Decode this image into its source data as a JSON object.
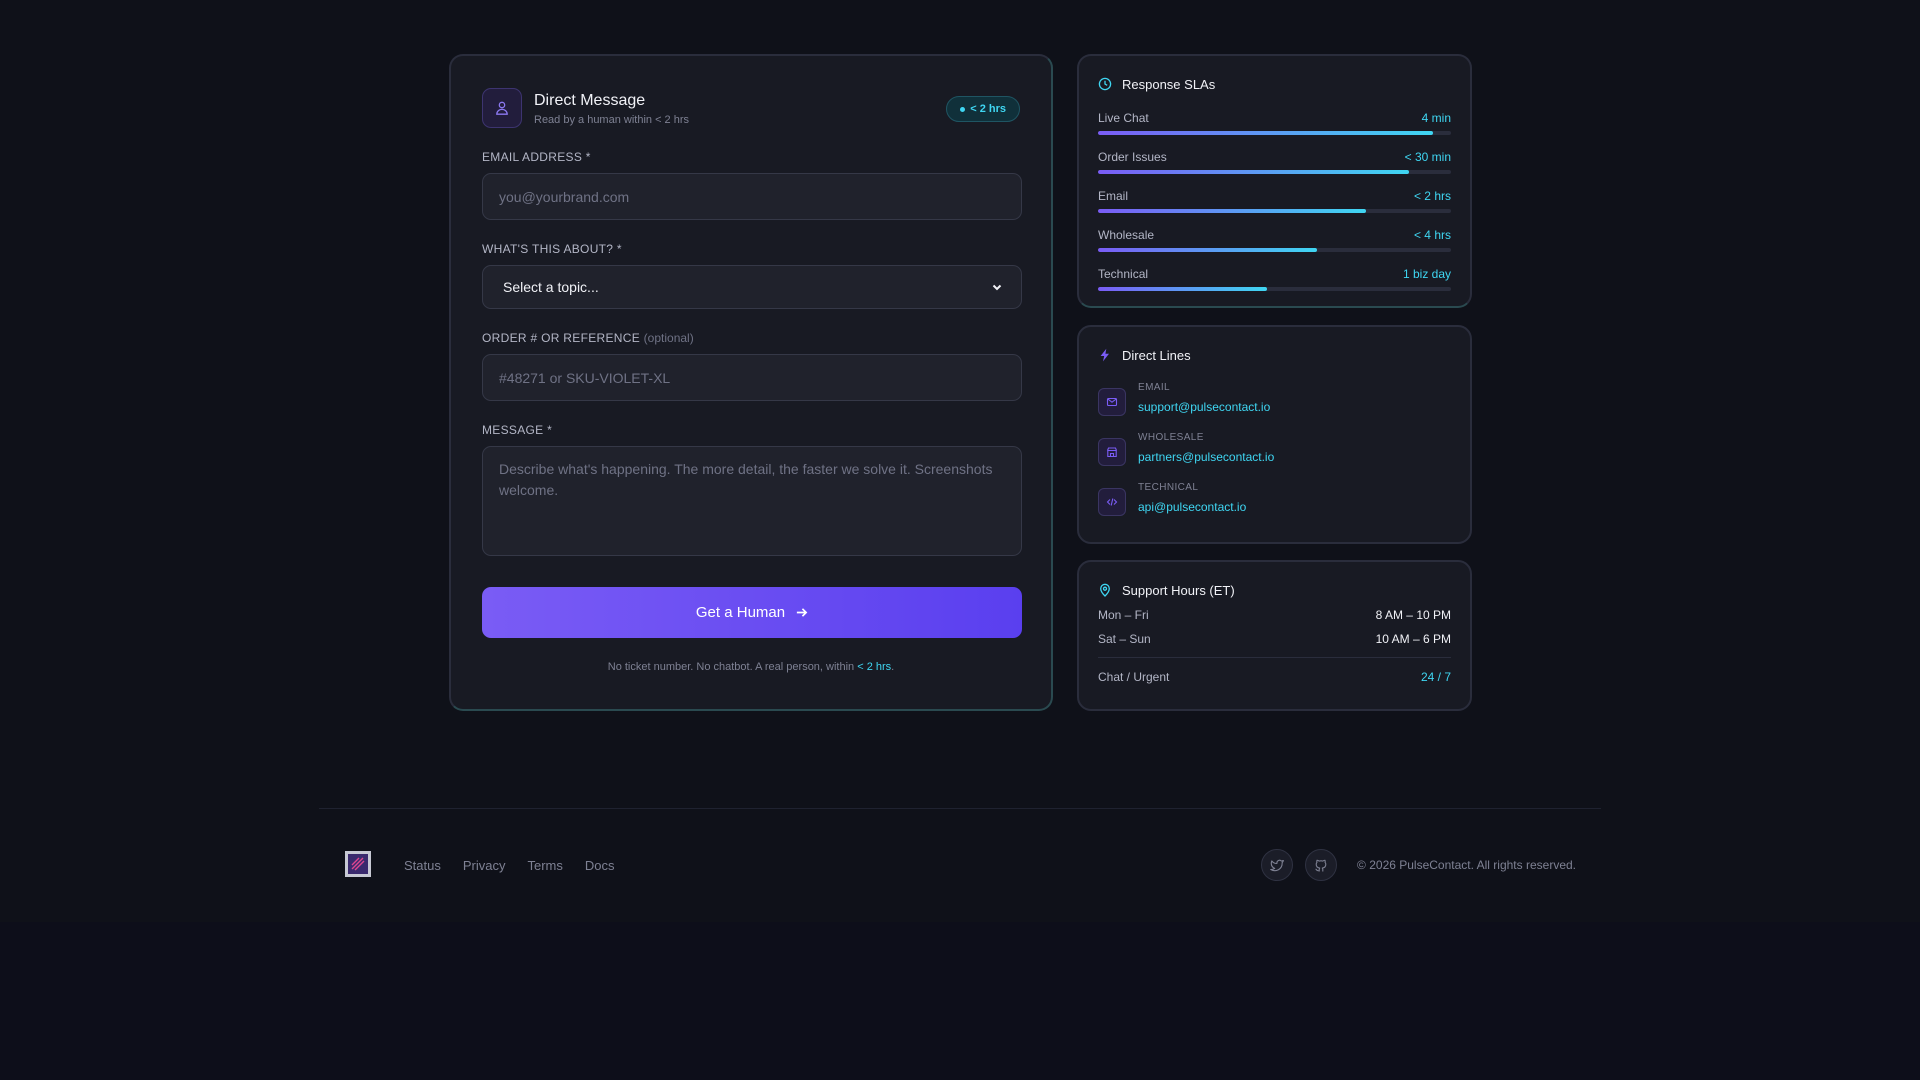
{
  "form": {
    "title": "Direct Message",
    "subtitle": "Read by a human within < 2 hrs",
    "badge": "< 2 hrs",
    "email_label": "EMAIL ADDRESS *",
    "email_placeholder": "you@yourbrand.com",
    "topic_label": "WHAT'S THIS ABOUT? *",
    "topic_value": "Select a topic...",
    "order_label": "ORDER # OR REFERENCE",
    "order_optional": "(optional)",
    "order_placeholder": "#48271 or SKU-VIOLET-XL",
    "message_label": "MESSAGE *",
    "message_placeholder": "Describe what's happening. The more detail, the faster we solve it. Screenshots welcome.",
    "submit_label": "Get a Human",
    "footnote_prefix": "No ticket number. No chatbot. A real person, within",
    "footnote_highlight": "< 2 hrs",
    "footnote_suffix": "."
  },
  "sla": {
    "title": "Response SLAs",
    "rows": [
      {
        "name": "Live Chat",
        "value": "4 min",
        "fill": 0.95
      },
      {
        "name": "Order Issues",
        "value": "< 30 min",
        "fill": 0.88
      },
      {
        "name": "Email",
        "value": "< 2 hrs",
        "fill": 0.76
      },
      {
        "name": "Wholesale",
        "value": "< 4 hrs",
        "fill": 0.62
      },
      {
        "name": "Technical",
        "value": "1 biz day",
        "fill": 0.48
      }
    ]
  },
  "direct_lines": {
    "title": "Direct Lines",
    "items": [
      {
        "label": "EMAIL",
        "value": "support@pulsecontact.io",
        "icon": "mail-icon"
      },
      {
        "label": "WHOLESALE",
        "value": "partners@pulsecontact.io",
        "icon": "store-icon"
      },
      {
        "label": "TECHNICAL",
        "value": "api@pulsecontact.io",
        "icon": "code-icon"
      }
    ]
  },
  "hours": {
    "title": "Support Hours (ET)",
    "rows": [
      {
        "day": "Mon – Fri",
        "time": "8 AM – 10 PM"
      },
      {
        "day": "Sat – Sun",
        "time": "10 AM – 6 PM"
      }
    ],
    "chat_label": "Chat / Urgent",
    "chat_value": "24 / 7"
  },
  "footer": {
    "links": [
      "Status",
      "Privacy",
      "Terms",
      "Docs"
    ],
    "copyright": "© 2026 PulseContact. All rights reserved."
  },
  "colors": {
    "accent_cyan": "#3fd6f2",
    "accent_violet": "#7a5cf5"
  }
}
